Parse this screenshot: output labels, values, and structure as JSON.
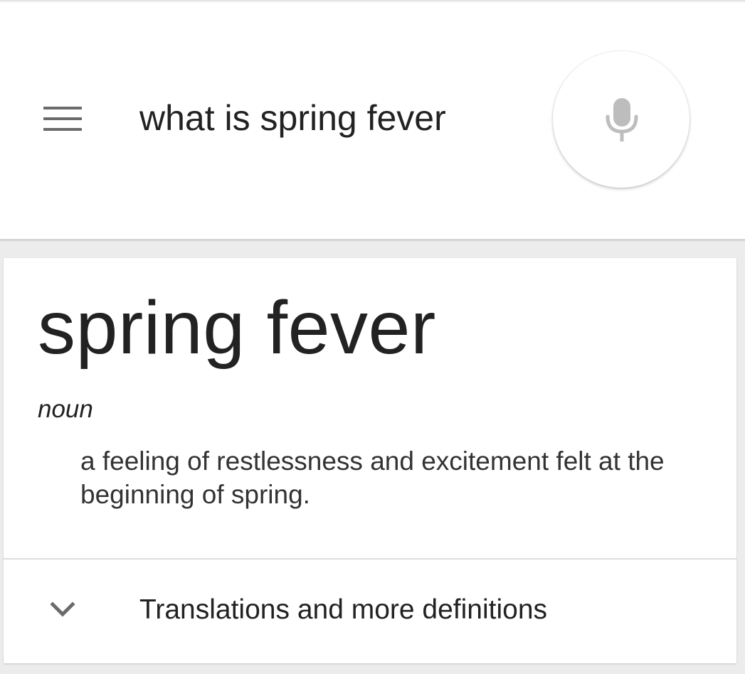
{
  "search": {
    "query": "what is spring fever",
    "menu_icon": "menu-icon",
    "mic_icon": "microphone-icon"
  },
  "definition_card": {
    "term": "spring fever",
    "part_of_speech": "noun",
    "definition": "a feeling of restlessness and excitement felt at the beginning of spring.",
    "more_label": "Translations and more definitions",
    "expand_icon": "chevron-down-icon"
  },
  "colors": {
    "background": "#ececec",
    "card": "#ffffff",
    "text": "#222222",
    "icon": "#6b6b6b"
  }
}
